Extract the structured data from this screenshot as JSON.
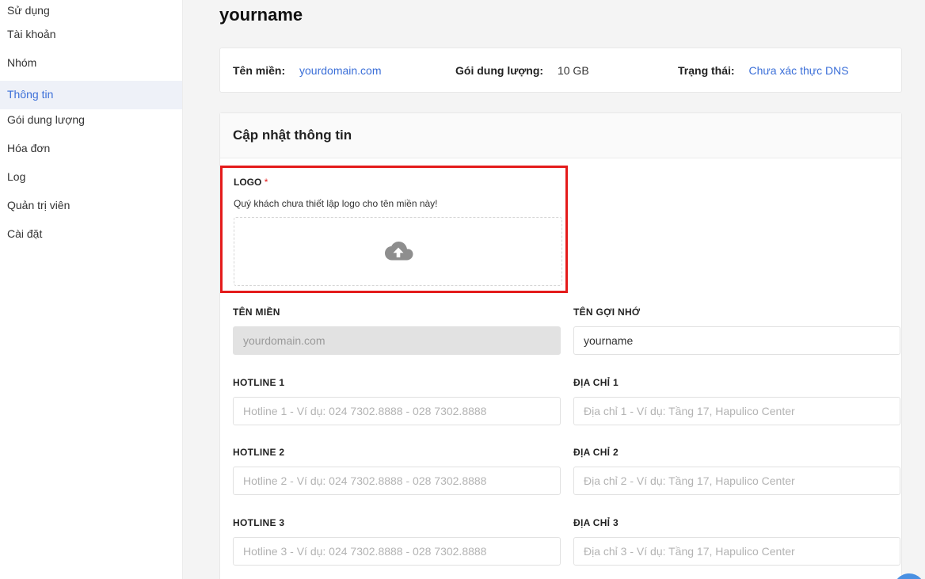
{
  "sidebar": {
    "items": [
      {
        "label": "Sử dụng"
      },
      {
        "label": "Tài khoản"
      },
      {
        "label": "Nhóm"
      },
      {
        "label": "Thông tin",
        "active": true
      },
      {
        "label": "Gói dung lượng"
      },
      {
        "label": "Hóa đơn"
      },
      {
        "label": "Log"
      },
      {
        "label": "Quản trị viên"
      },
      {
        "label": "Cài đặt"
      }
    ]
  },
  "page": {
    "title": "yourname"
  },
  "info": {
    "domain_label": "Tên miền:",
    "domain_value": "yourdomain.com",
    "storage_label": "Gói dung lượng:",
    "storage_value": "10 GB",
    "status_label": "Trạng thái:",
    "status_value": "Chưa xác thực DNS"
  },
  "form": {
    "title": "Cập nhật thông tin",
    "logo": {
      "label": "LOGO",
      "required_mark": "*",
      "note": "Quý khách chưa thiết lập logo cho tên miền này!",
      "upload_icon": "cloud-upload-icon"
    },
    "domain": {
      "label": "TÊN MIỀN",
      "value": "yourdomain.com"
    },
    "alias": {
      "label": "TÊN GỢI NHỚ",
      "value": "yourname"
    },
    "hotline1": {
      "label": "HOTLINE 1",
      "placeholder": "Hotline 1 - Ví dụ: 024 7302.8888 - 028 7302.8888"
    },
    "address1": {
      "label": "ĐỊA CHỈ 1",
      "placeholder": "Địa chỉ 1 - Ví dụ: Tầng 17, Hapulico Center"
    },
    "hotline2": {
      "label": "HOTLINE 2",
      "placeholder": "Hotline 2 - Ví dụ: 024 7302.8888 - 028 7302.8888"
    },
    "address2": {
      "label": "ĐỊA CHỈ 2",
      "placeholder": "Địa chỉ 2 - Ví dụ: Tầng 17, Hapulico Center"
    },
    "hotline3": {
      "label": "HOTLINE 3",
      "placeholder": "Hotline 3 - Ví dụ: 024 7302.8888 - 028 7302.8888"
    },
    "address3": {
      "label": "ĐỊA CHỈ 3",
      "placeholder": "Địa chỉ 3 - Ví dụ: Tầng 17, Hapulico Center"
    }
  },
  "colors": {
    "accent": "#3b6fd8",
    "highlight": "#e41b1b"
  }
}
